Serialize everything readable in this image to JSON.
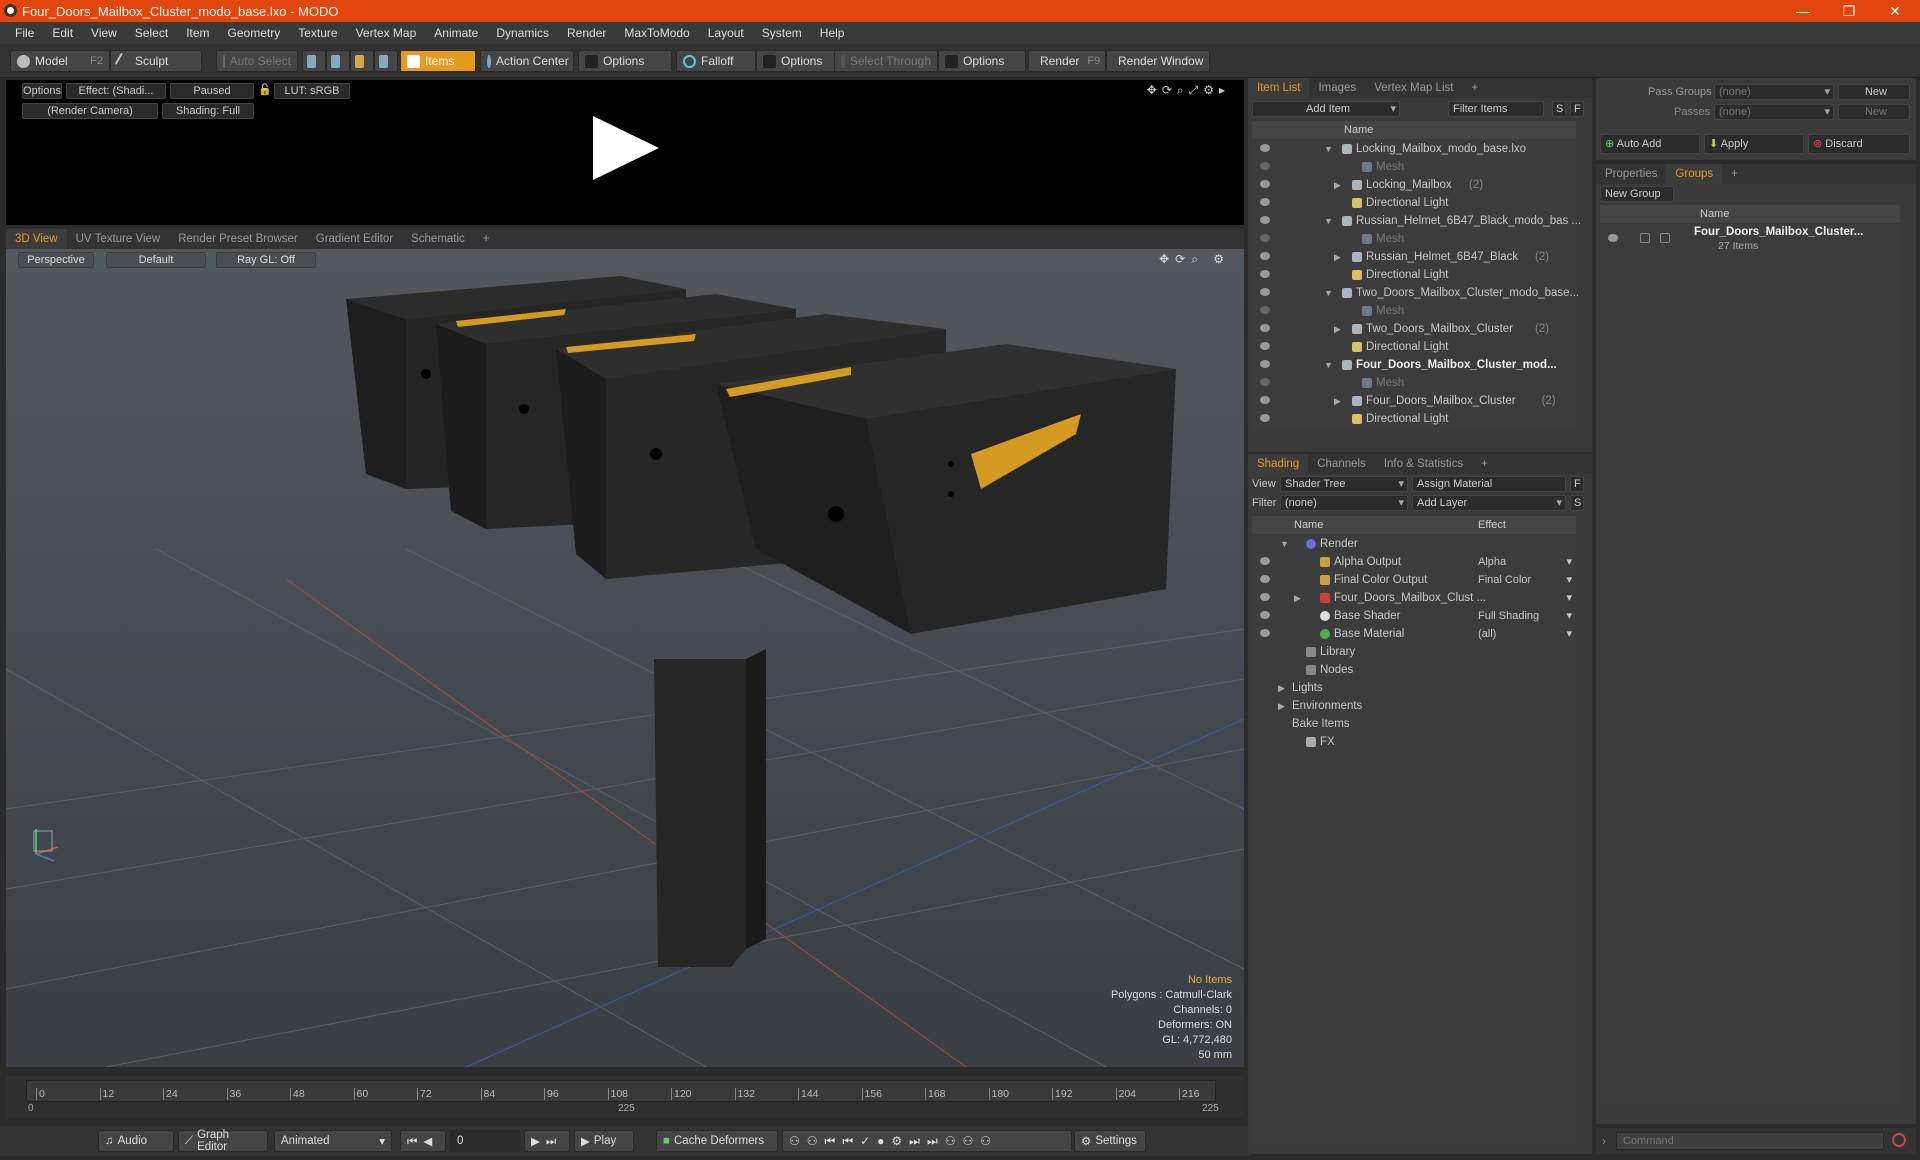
{
  "window": {
    "title": "Four_Doors_Mailbox_Cluster_modo_base.lxo - MODO"
  },
  "menu": [
    "File",
    "Edit",
    "View",
    "Select",
    "Item",
    "Geometry",
    "Texture",
    "Vertex Map",
    "Animate",
    "Dynamics",
    "Render",
    "MaxToModo",
    "Layout",
    "System",
    "Help"
  ],
  "toolbar": {
    "model": "Model",
    "model_key": "F2",
    "sculpt": "Sculpt",
    "auto_select": "Auto Select",
    "items": "Items",
    "action_center": "Action Center",
    "options1": "Options",
    "falloff": "Falloff",
    "options2": "Options",
    "select_through": "Select Through",
    "options3": "Options",
    "render": "Render",
    "render_key": "F9",
    "render_window": "Render Window"
  },
  "preview": {
    "options": "Options",
    "effect": "Effect: (Shadi...",
    "paused": "Paused",
    "lut": "LUT: sRGB",
    "camera": "(Render Camera)",
    "shading": "Shading: Full"
  },
  "viewtabs": [
    "3D View",
    "UV Texture View",
    "Render Preset Browser",
    "Gradient Editor",
    "Schematic"
  ],
  "viewport": {
    "perspective": "Perspective",
    "default": "Default",
    "raygl": "Ray GL: Off",
    "stats": {
      "no_items": "No Items",
      "polygons": "Polygons : Catmull-Clark",
      "channels": "Channels: 0",
      "deformers": "Deformers: ON",
      "gl": "GL: 4,772,480",
      "focal": "50 mm"
    }
  },
  "timeline": {
    "ticks": [
      "0",
      "12",
      "24",
      "36",
      "48",
      "60",
      "72",
      "84",
      "96",
      "108",
      "120",
      "132",
      "144",
      "156",
      "168",
      "180",
      "192",
      "204",
      "216"
    ],
    "start": "0",
    "mid": "225",
    "end": "225"
  },
  "bottombar": {
    "audio": "Audio",
    "graph_editor": "Graph Editor",
    "animated": "Animated",
    "frame": "0",
    "play": "Play",
    "cache": "Cache Deformers",
    "settings": "Settings"
  },
  "itemlist": {
    "tabs": [
      "Item List",
      "Images",
      "Vertex Map List"
    ],
    "add_item": "Add Item",
    "filter_items": "Filter Items",
    "s": "S",
    "f": "F",
    "col_name": "Name",
    "rows": [
      {
        "label": "Locking_Mailbox_modo_base.lxo",
        "indent": 0,
        "dim": false,
        "bold": false,
        "count": ""
      },
      {
        "label": "Mesh",
        "indent": 2,
        "dim": true,
        "bold": false,
        "count": ""
      },
      {
        "label": "Locking_Mailbox",
        "indent": 1,
        "dim": false,
        "bold": false,
        "count": "(2)"
      },
      {
        "label": "Directional Light",
        "indent": 1,
        "dim": false,
        "bold": false,
        "count": ""
      },
      {
        "label": "Russian_Helmet_6B47_Black_modo_bas ...",
        "indent": 0,
        "dim": false,
        "bold": false,
        "count": ""
      },
      {
        "label": "Mesh",
        "indent": 2,
        "dim": true,
        "bold": false,
        "count": ""
      },
      {
        "label": "Russian_Helmet_6B47_Black",
        "indent": 1,
        "dim": false,
        "bold": false,
        "count": "(2)"
      },
      {
        "label": "Directional Light",
        "indent": 1,
        "dim": false,
        "bold": false,
        "count": ""
      },
      {
        "label": "Two_Doors_Mailbox_Cluster_modo_base...",
        "indent": 0,
        "dim": false,
        "bold": false,
        "count": ""
      },
      {
        "label": "Mesh",
        "indent": 2,
        "dim": true,
        "bold": false,
        "count": ""
      },
      {
        "label": "Two_Doors_Mailbox_Cluster",
        "indent": 1,
        "dim": false,
        "bold": false,
        "count": "(2)"
      },
      {
        "label": "Directional Light",
        "indent": 1,
        "dim": false,
        "bold": false,
        "count": ""
      },
      {
        "label": "Four_Doors_Mailbox_Cluster_mod...",
        "indent": 0,
        "dim": false,
        "bold": true,
        "count": ""
      },
      {
        "label": "Mesh",
        "indent": 2,
        "dim": true,
        "bold": false,
        "count": ""
      },
      {
        "label": "Four_Doors_Mailbox_Cluster",
        "indent": 1,
        "dim": false,
        "bold": false,
        "count": "(2)"
      },
      {
        "label": "Directional Light",
        "indent": 1,
        "dim": false,
        "bold": false,
        "count": ""
      }
    ]
  },
  "shading": {
    "tabs": [
      "Shading",
      "Channels",
      "Info & Statistics"
    ],
    "view_label": "View",
    "view_value": "Shader Tree",
    "assign": "Assign Material",
    "f": "F",
    "filter_label": "Filter",
    "filter_value": "(none)",
    "add_layer": "Add Layer",
    "s": "S",
    "col_name": "Name",
    "col_effect": "Effect",
    "rows": [
      {
        "label": "Render",
        "effect": "",
        "indent": 0
      },
      {
        "label": "Alpha Output",
        "effect": "Alpha",
        "indent": 1
      },
      {
        "label": "Final Color Output",
        "effect": "Final Color",
        "indent": 1
      },
      {
        "label": "Four_Doors_Mailbox_Clust ...",
        "effect": "",
        "indent": 1
      },
      {
        "label": "Base Shader",
        "effect": "Full Shading",
        "indent": 1
      },
      {
        "label": "Base Material",
        "effect": "(all)",
        "indent": 1
      },
      {
        "label": "Library",
        "effect": "",
        "indent": 0
      },
      {
        "label": "Nodes",
        "effect": "",
        "indent": 0
      },
      {
        "label": "Lights",
        "effect": "",
        "indent": -1
      },
      {
        "label": "Environments",
        "effect": "",
        "indent": -1
      },
      {
        "label": "Bake Items",
        "effect": "",
        "indent": -1
      },
      {
        "label": "FX",
        "effect": "",
        "indent": 0
      }
    ]
  },
  "passes": {
    "pass_groups": "Pass Groups",
    "pass_value": "(none)",
    "new": "New",
    "passes": "Passes",
    "passes_value": "(none)",
    "new2": "New",
    "auto_add": "Auto Add",
    "apply": "Apply",
    "discard": "Discard"
  },
  "groups": {
    "tabs": [
      "Properties",
      "Groups"
    ],
    "new_group": "New Group",
    "col_name": "Name",
    "item": "Four_Doors_Mailbox_Cluster...",
    "count": "27 Items"
  },
  "command": {
    "placeholder": "Command"
  }
}
